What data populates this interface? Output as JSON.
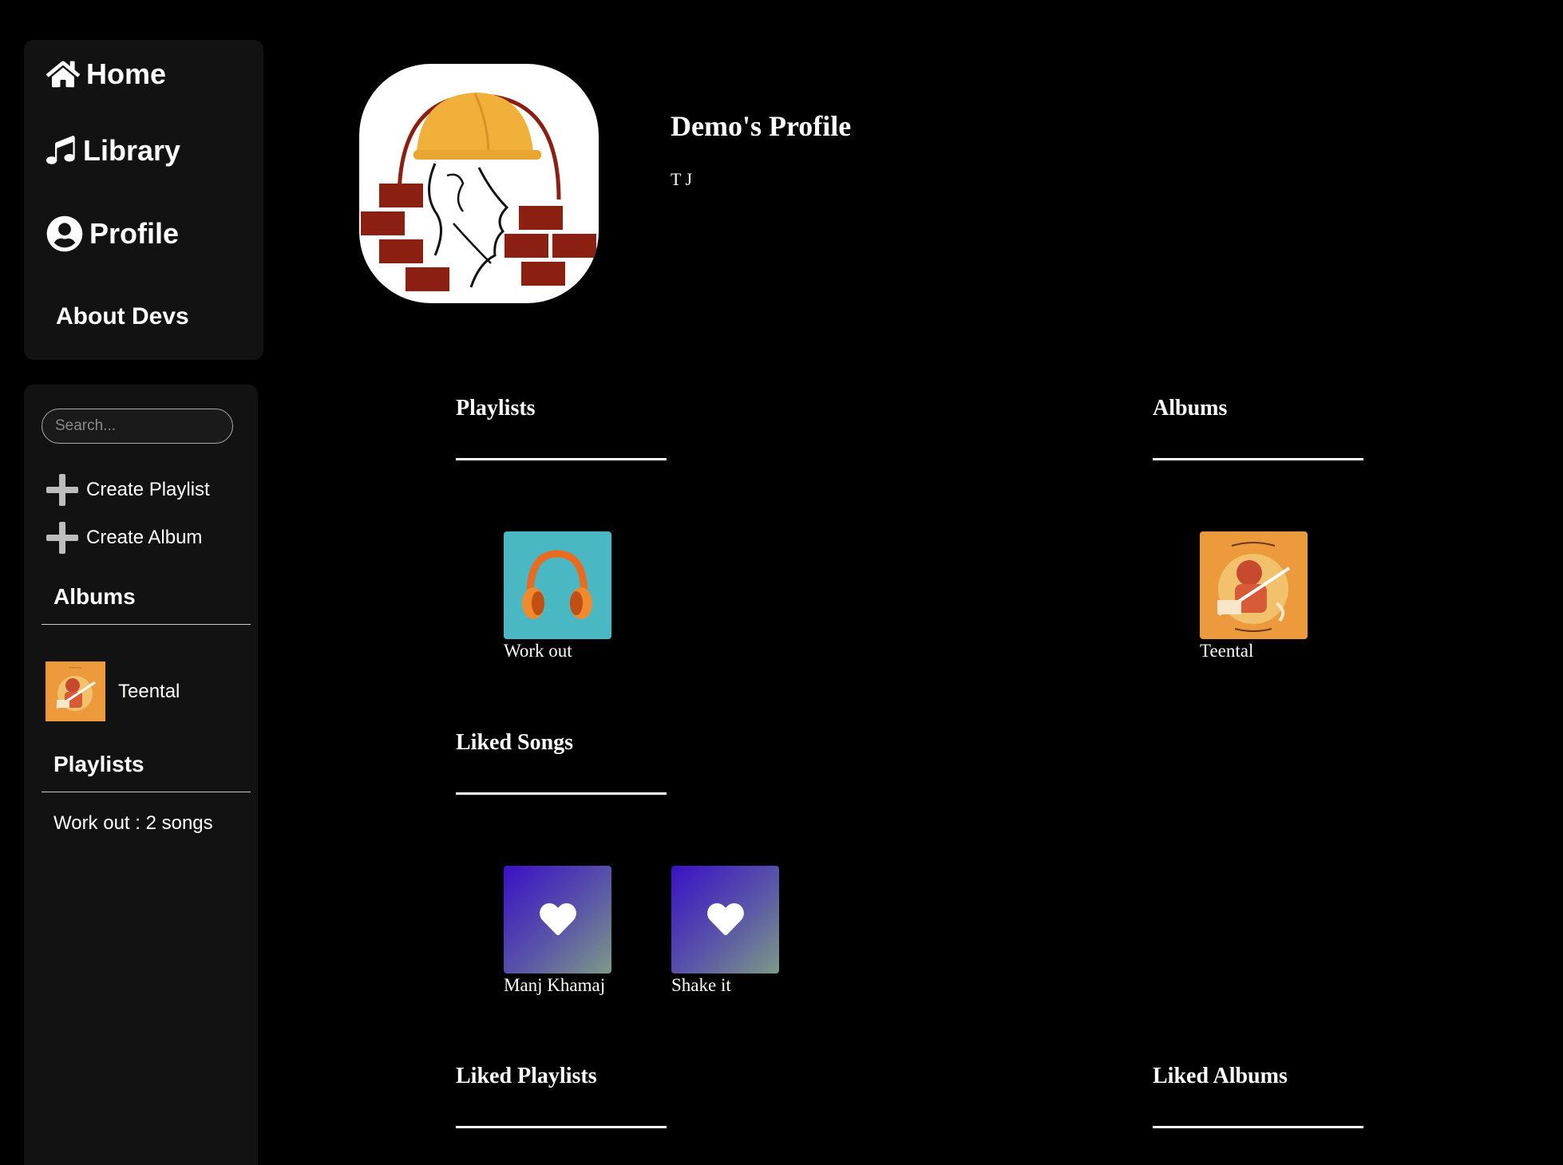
{
  "nav": {
    "home": "Home",
    "library": "Library",
    "profile": "Profile",
    "about": "About Devs"
  },
  "library": {
    "search_placeholder": "Search...",
    "create_playlist": "Create Playlist",
    "create_album": "Create Album",
    "albums_heading": "Albums",
    "albums": [
      {
        "name": "Teental"
      }
    ],
    "playlists_heading": "Playlists",
    "playlists": [
      {
        "label": "Work out : 2 songs"
      }
    ]
  },
  "profile": {
    "title": "Demo's Profile",
    "subtitle": "T J"
  },
  "sections": {
    "playlists": {
      "title": "Playlists",
      "items": [
        {
          "name": "Work out"
        }
      ]
    },
    "albums": {
      "title": "Albums",
      "items": [
        {
          "name": "Teental"
        }
      ]
    },
    "liked_songs": {
      "title": "Liked Songs",
      "items": [
        {
          "name": "Manj Khamaj"
        },
        {
          "name": "Shake it"
        }
      ]
    },
    "liked_playlists": {
      "title": "Liked Playlists"
    },
    "liked_albums": {
      "title": "Liked Albums"
    }
  },
  "colors": {
    "background": "#000000",
    "panel": "#121212",
    "playlist_art": "#4ab8c2",
    "album_art": "#ec9a3c",
    "liked_gradient_start": "#3a10c6",
    "liked_gradient_end": "#7d9a86"
  },
  "icons": [
    "home-icon",
    "music-note-icon",
    "user-circle-icon",
    "plus-icon",
    "headphones-icon",
    "heart-icon"
  ]
}
